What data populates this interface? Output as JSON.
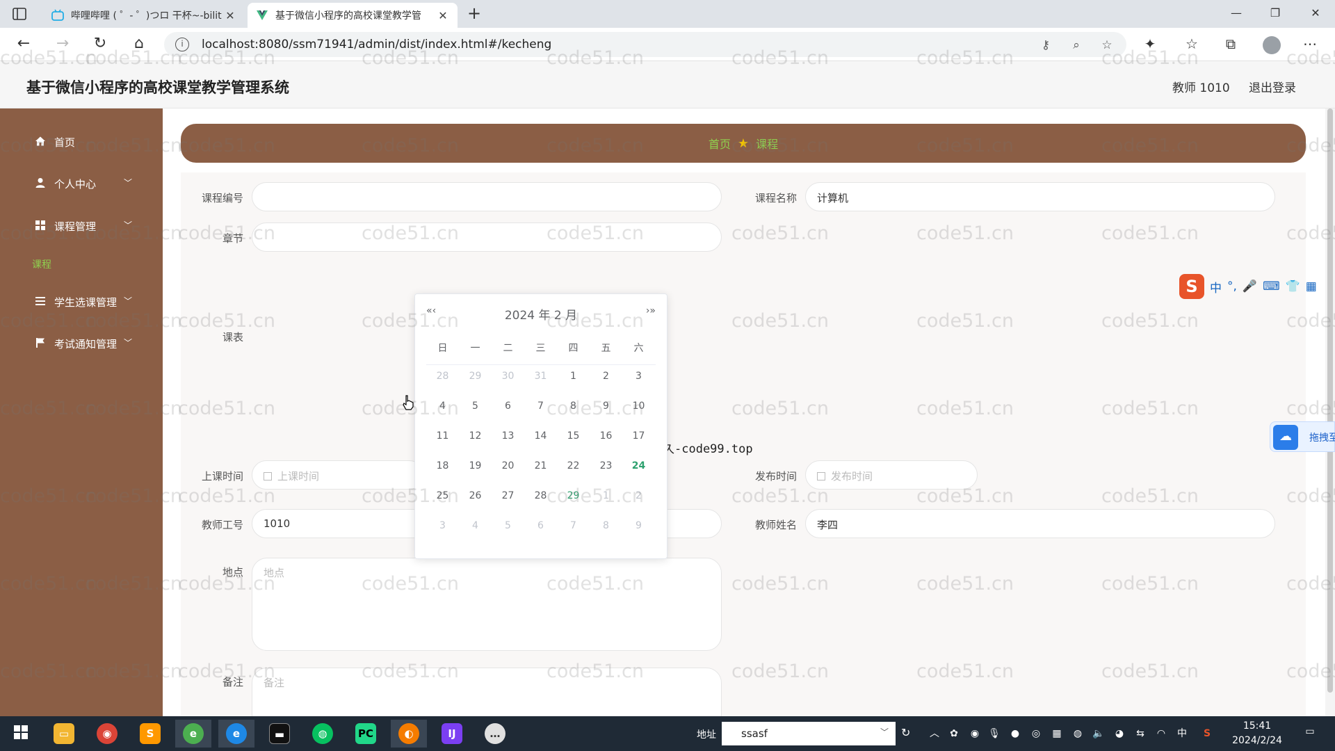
{
  "browser": {
    "tabs": [
      {
        "title": "哔哩哔哩 ( ゜- ゜)つロ 干杯~-bilit",
        "active": false
      },
      {
        "title": "基于微信小程序的高校课堂教学管",
        "active": true
      }
    ],
    "url": "localhost:8080/ssm71941/admin/dist/index.html#/kecheng"
  },
  "header": {
    "title": "基于微信小程序的高校课堂教学管理系统",
    "user": "教师 1010",
    "logout": "退出登录"
  },
  "sidebar": {
    "items": [
      {
        "label": "首页",
        "icon": "home-icon"
      },
      {
        "label": "个人中心",
        "icon": "user-icon"
      },
      {
        "label": "课程管理",
        "icon": "grid-icon"
      },
      {
        "label": "课程",
        "icon": ""
      },
      {
        "label": "学生选课管理",
        "icon": "list-icon"
      },
      {
        "label": "考试通知管理",
        "icon": "flag-icon"
      }
    ]
  },
  "breadcrumb": {
    "home": "首页",
    "current": "课程"
  },
  "form": {
    "course_no_label": "课程编号",
    "course_name_label": "课程名称",
    "course_name_value": "计算机",
    "chapter_label": "章节",
    "schedule_label": "课表",
    "schedule_text": "源码久久-code99.top",
    "class_time_label": "上课时间",
    "class_time_placeholder": "上课时间",
    "publish_time_label": "发布时间",
    "publish_time_placeholder": "发布时间",
    "teacher_no_label": "教师工号",
    "teacher_no_value": "1010",
    "teacher_name_label": "教师姓名",
    "teacher_name_value": "李四",
    "location_label": "地点",
    "location_placeholder": "地点",
    "remark_label": "备注",
    "remark_placeholder": "备注"
  },
  "datepicker": {
    "title": "2024 年  2 月",
    "prev": "«‹",
    "next": "›»",
    "weekdays": [
      "日",
      "一",
      "二",
      "三",
      "四",
      "五",
      "六"
    ],
    "weeks": [
      [
        "28",
        "29",
        "30",
        "31",
        "1",
        "2",
        "3"
      ],
      [
        "4",
        "5",
        "6",
        "7",
        "8",
        "9",
        "10"
      ],
      [
        "11",
        "12",
        "13",
        "14",
        "15",
        "16",
        "17"
      ],
      [
        "18",
        "19",
        "20",
        "21",
        "22",
        "23",
        "24"
      ],
      [
        "25",
        "26",
        "27",
        "28",
        "29",
        "1",
        "2"
      ],
      [
        "3",
        "4",
        "5",
        "6",
        "7",
        "8",
        "9"
      ]
    ],
    "today": "24",
    "hovered": "29"
  },
  "watermark": "code51.cn",
  "widgets": {
    "ime": [
      "中",
      "°,",
      "🎤",
      "⌨",
      "👕",
      "▦"
    ],
    "ime_logo": "S",
    "drag_label": "拖拽至"
  },
  "taskbar": {
    "address_label": "地址",
    "address_value": "ssasf",
    "tray_lang": "中",
    "time": "15:41",
    "date": "2024/2/24"
  },
  "colors": {
    "sidebar": "#8b5e45",
    "accent_green": "#8fd14f",
    "today_green": "#2ea16f"
  }
}
